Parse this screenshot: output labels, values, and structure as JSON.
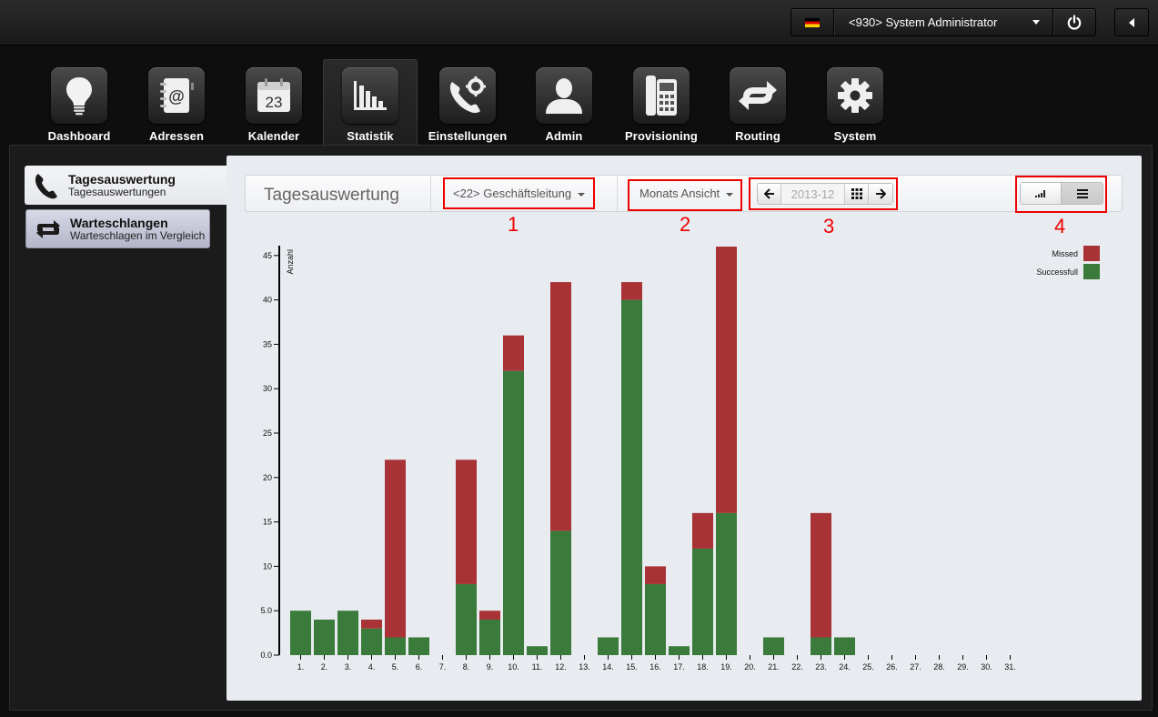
{
  "topbar": {
    "user_label": "<930> System Administrator"
  },
  "nav": {
    "items": [
      {
        "label": "Dashboard",
        "icon": "lightbulb-icon"
      },
      {
        "label": "Adressen",
        "icon": "address-book-icon"
      },
      {
        "label": "Kalender",
        "icon": "calendar-icon",
        "icon_text": "23"
      },
      {
        "label": "Statistik",
        "icon": "bar-chart-icon",
        "active": true
      },
      {
        "label": "Einstellungen",
        "icon": "phone-gear-icon"
      },
      {
        "label": "Admin",
        "icon": "user-icon"
      },
      {
        "label": "Provisioning",
        "icon": "desk-phone-icon"
      },
      {
        "label": "Routing",
        "icon": "routing-arrows-icon"
      },
      {
        "label": "System",
        "icon": "gear-icon"
      }
    ]
  },
  "sidebar": {
    "items": [
      {
        "title": "Tagesauswertung",
        "subtitle": "Tagesauswertungen",
        "icon": "phone-icon",
        "active": true
      },
      {
        "title": "Warteschlangen",
        "subtitle": "Warteschlagen im Vergleich",
        "icon": "loop-arrows-icon"
      }
    ]
  },
  "toolbar": {
    "title": "Tagesauswertung",
    "group_select": "<22> Geschäftsleitung",
    "view_select": "Monats Ansicht",
    "date_value": "2013-12"
  },
  "annotations": [
    "1",
    "2",
    "3",
    "4"
  ],
  "colors": {
    "missed": "#a83236",
    "successful": "#3a7a3a"
  },
  "chart_data": {
    "type": "bar",
    "stacked": true,
    "ylabel": "Anzahl",
    "ylim": [
      0,
      46
    ],
    "yticks": [
      "0.0",
      "5.0",
      "10",
      "15",
      "20",
      "25",
      "30",
      "35",
      "40",
      "45"
    ],
    "categories": [
      "1.",
      "2.",
      "3.",
      "4.",
      "5.",
      "6.",
      "7.",
      "8.",
      "9.",
      "10.",
      "11.",
      "12.",
      "13.",
      "14.",
      "15.",
      "16.",
      "17.",
      "18.",
      "19.",
      "20.",
      "21.",
      "22.",
      "23.",
      "24.",
      "25.",
      "26.",
      "27.",
      "28.",
      "29.",
      "30.",
      "31."
    ],
    "series": [
      {
        "name": "Successfull",
        "values": [
          5,
          4,
          5,
          3,
          2,
          2,
          0,
          8,
          4,
          32,
          1,
          14,
          0,
          2,
          40,
          8,
          1,
          12,
          16,
          0,
          2,
          0,
          2,
          2,
          0,
          0,
          0,
          0,
          0,
          0,
          0
        ]
      },
      {
        "name": "Missed",
        "values": [
          0,
          0,
          0,
          1,
          20,
          0,
          0,
          14,
          1,
          4,
          0,
          28,
          0,
          0,
          2,
          2,
          0,
          4,
          30,
          0,
          0,
          0,
          14,
          0,
          0,
          0,
          0,
          0,
          0,
          0,
          0
        ]
      }
    ],
    "legend_position": "top-right"
  }
}
